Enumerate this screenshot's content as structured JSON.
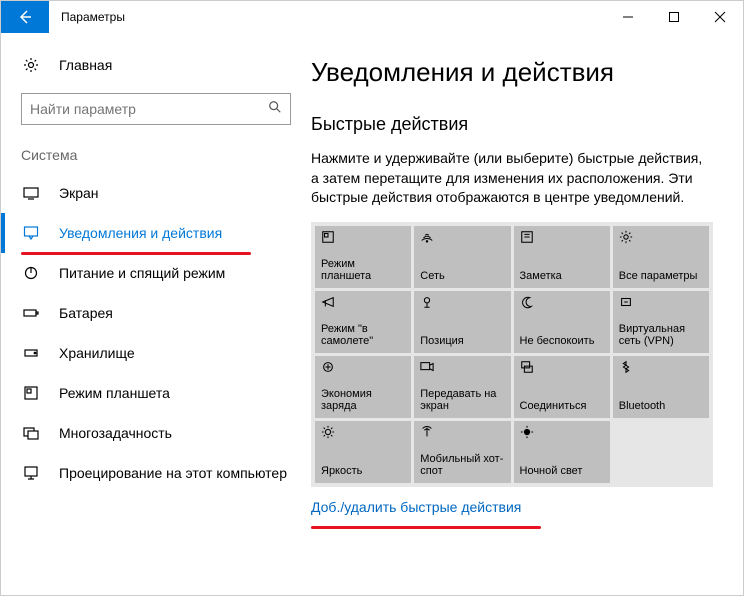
{
  "window": {
    "title": "Параметры"
  },
  "sidebar": {
    "home": "Главная",
    "search_placeholder": "Найти параметр",
    "group": "Система",
    "items": [
      {
        "label": "Экран"
      },
      {
        "label": "Уведомления и действия"
      },
      {
        "label": "Питание и спящий режим"
      },
      {
        "label": "Батарея"
      },
      {
        "label": "Хранилище"
      },
      {
        "label": "Режим планшета"
      },
      {
        "label": "Многозадачность"
      },
      {
        "label": "Проецирование на этот компьютер"
      }
    ]
  },
  "main": {
    "title": "Уведомления и действия",
    "section_title": "Быстрые действия",
    "description": "Нажмите и удерживайте (или выберите) быстрые действия, а затем перетащите для изменения их расположения. Эти быстрые действия отображаются в центре уведомлений.",
    "link": "Доб./удалить быстрые действия",
    "tiles": [
      {
        "label": "Режим планшета"
      },
      {
        "label": "Сеть"
      },
      {
        "label": "Заметка"
      },
      {
        "label": "Все параметры"
      },
      {
        "label": "Режим \"в самолете\""
      },
      {
        "label": "Позиция"
      },
      {
        "label": "Не беспокоить"
      },
      {
        "label": "Виртуальная сеть (VPN)"
      },
      {
        "label": "Экономия заряда"
      },
      {
        "label": "Передавать на экран"
      },
      {
        "label": "Соединиться"
      },
      {
        "label": "Bluetooth"
      },
      {
        "label": "Яркость"
      },
      {
        "label": "Мобильный хот-спот"
      },
      {
        "label": "Ночной свет"
      }
    ]
  }
}
